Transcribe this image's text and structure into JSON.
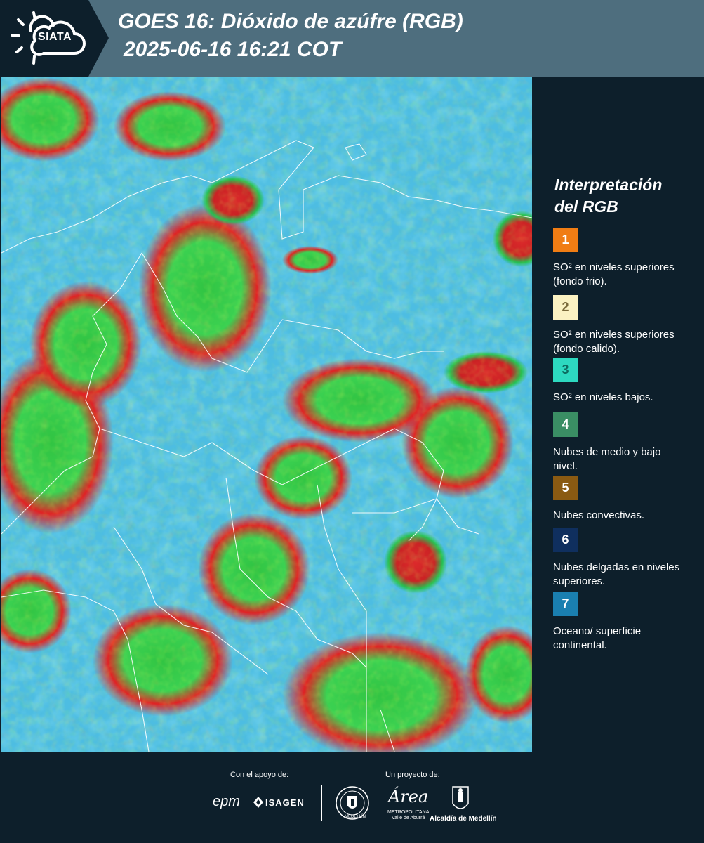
{
  "header": {
    "logo_text": "SIATA",
    "title_line1": "GOES 16: Dióxido de azúfre (RGB)",
    "title_line2": "2025-06-16 16:21 COT"
  },
  "legend": {
    "title_line1": "Interpretación",
    "title_line2": "del RGB",
    "items": [
      {
        "number": "1",
        "color": "#f07d14",
        "text_color": "#ffffff",
        "text": "SO² en niveles superiores (fondo frio)."
      },
      {
        "number": "2",
        "color": "#fbf2c2",
        "text_color": "#7a6a3a",
        "text": "SO² en niveles superiores (fondo calido)."
      },
      {
        "number": "3",
        "color": "#2dd9c0",
        "text_color": "#0d6b60",
        "text": "SO² en niveles bajos."
      },
      {
        "number": "4",
        "color": "#3a8e64",
        "text_color": "#ffffff",
        "text": "Nubes de medio y bajo nivel."
      },
      {
        "number": "5",
        "color": "#8a5a12",
        "text_color": "#ffffff",
        "text": "Nubes convectivas."
      },
      {
        "number": "6",
        "color": "#0f2f5e",
        "text_color": "#ffffff",
        "text": "Nubes delgadas en niveles superiores."
      },
      {
        "number": "7",
        "color": "#1a7fb0",
        "text_color": "#ffffff",
        "text": "Oceano/ superficie continental."
      }
    ]
  },
  "footer": {
    "support_label": "Con el apoyo de:",
    "project_label": "Un proyecto de:",
    "sponsor_epm": "epm",
    "sponsor_isagen": "ISAGEN",
    "partner_area": "Área",
    "partner_area_sub": "METROPOLITANA",
    "partner_area_sub2": "Valle de Aburrá",
    "partner_alcaldia": "Alcaldía de Medellín",
    "partner_medellin_seal": "MEDELLÍN"
  }
}
